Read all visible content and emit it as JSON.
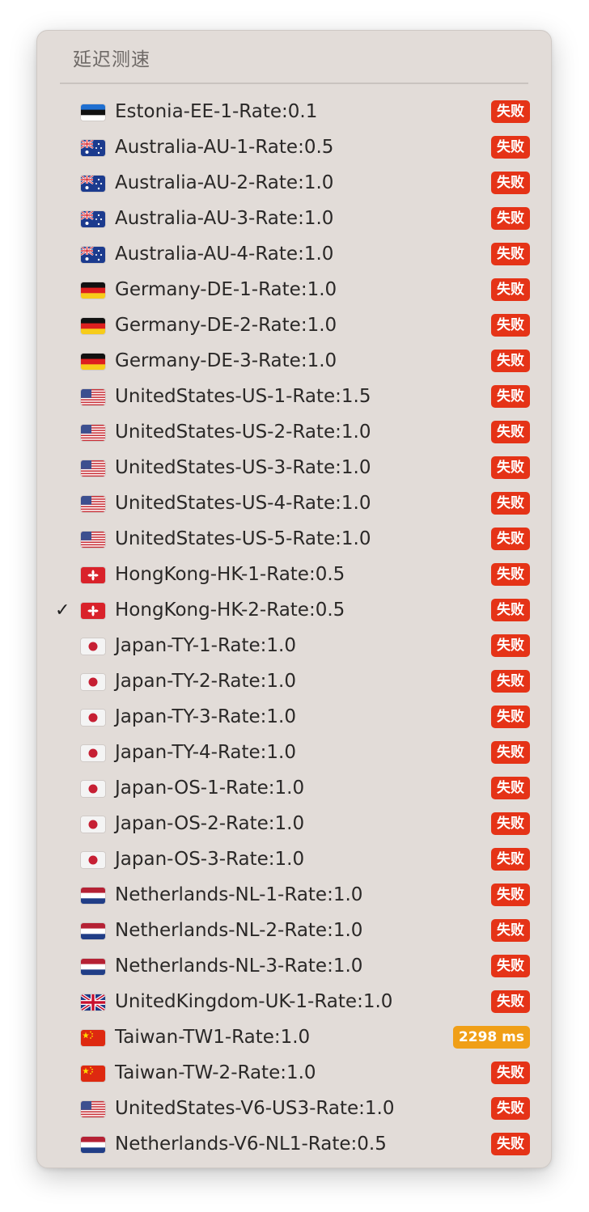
{
  "menu": {
    "title": "延迟测速"
  },
  "colors": {
    "fail_badge": "#e53317",
    "latency_badge": "#f09f17",
    "menu_background": "#e2dcd8"
  },
  "servers": [
    {
      "name": "Estonia-EE-1-Rate:0.1",
      "flag": "estonia-flag-icon",
      "status": "失败",
      "status_type": "fail",
      "selected": false
    },
    {
      "name": "Australia-AU-1-Rate:0.5",
      "flag": "australia-flag-icon",
      "status": "失败",
      "status_type": "fail",
      "selected": false
    },
    {
      "name": "Australia-AU-2-Rate:1.0",
      "flag": "australia-flag-icon",
      "status": "失败",
      "status_type": "fail",
      "selected": false
    },
    {
      "name": "Australia-AU-3-Rate:1.0",
      "flag": "australia-flag-icon",
      "status": "失败",
      "status_type": "fail",
      "selected": false
    },
    {
      "name": "Australia-AU-4-Rate:1.0",
      "flag": "australia-flag-icon",
      "status": "失败",
      "status_type": "fail",
      "selected": false
    },
    {
      "name": "Germany-DE-1-Rate:1.0",
      "flag": "germany-flag-icon",
      "status": "失败",
      "status_type": "fail",
      "selected": false
    },
    {
      "name": "Germany-DE-2-Rate:1.0",
      "flag": "germany-flag-icon",
      "status": "失败",
      "status_type": "fail",
      "selected": false
    },
    {
      "name": "Germany-DE-3-Rate:1.0",
      "flag": "germany-flag-icon",
      "status": "失败",
      "status_type": "fail",
      "selected": false
    },
    {
      "name": "UnitedStates-US-1-Rate:1.5",
      "flag": "usa-flag-icon",
      "status": "失败",
      "status_type": "fail",
      "selected": false
    },
    {
      "name": "UnitedStates-US-2-Rate:1.0",
      "flag": "usa-flag-icon",
      "status": "失败",
      "status_type": "fail",
      "selected": false
    },
    {
      "name": "UnitedStates-US-3-Rate:1.0",
      "flag": "usa-flag-icon",
      "status": "失败",
      "status_type": "fail",
      "selected": false
    },
    {
      "name": "UnitedStates-US-4-Rate:1.0",
      "flag": "usa-flag-icon",
      "status": "失败",
      "status_type": "fail",
      "selected": false
    },
    {
      "name": "UnitedStates-US-5-Rate:1.0",
      "flag": "usa-flag-icon",
      "status": "失败",
      "status_type": "fail",
      "selected": false
    },
    {
      "name": "HongKong-HK-1-Rate:0.5",
      "flag": "hongkong-flag-icon",
      "status": "失败",
      "status_type": "fail",
      "selected": false
    },
    {
      "name": "HongKong-HK-2-Rate:0.5",
      "flag": "hongkong-flag-icon",
      "status": "失败",
      "status_type": "fail",
      "selected": true
    },
    {
      "name": "Japan-TY-1-Rate:1.0",
      "flag": "japan-flag-icon",
      "status": "失败",
      "status_type": "fail",
      "selected": false
    },
    {
      "name": "Japan-TY-2-Rate:1.0",
      "flag": "japan-flag-icon",
      "status": "失败",
      "status_type": "fail",
      "selected": false
    },
    {
      "name": "Japan-TY-3-Rate:1.0",
      "flag": "japan-flag-icon",
      "status": "失败",
      "status_type": "fail",
      "selected": false
    },
    {
      "name": "Japan-TY-4-Rate:1.0",
      "flag": "japan-flag-icon",
      "status": "失败",
      "status_type": "fail",
      "selected": false
    },
    {
      "name": "Japan-OS-1-Rate:1.0",
      "flag": "japan-flag-icon",
      "status": "失败",
      "status_type": "fail",
      "selected": false
    },
    {
      "name": "Japan-OS-2-Rate:1.0",
      "flag": "japan-flag-icon",
      "status": "失败",
      "status_type": "fail",
      "selected": false
    },
    {
      "name": "Japan-OS-3-Rate:1.0",
      "flag": "japan-flag-icon",
      "status": "失败",
      "status_type": "fail",
      "selected": false
    },
    {
      "name": "Netherlands-NL-1-Rate:1.0",
      "flag": "netherlands-flag-icon",
      "status": "失败",
      "status_type": "fail",
      "selected": false
    },
    {
      "name": "Netherlands-NL-2-Rate:1.0",
      "flag": "netherlands-flag-icon",
      "status": "失败",
      "status_type": "fail",
      "selected": false
    },
    {
      "name": "Netherlands-NL-3-Rate:1.0",
      "flag": "netherlands-flag-icon",
      "status": "失败",
      "status_type": "fail",
      "selected": false
    },
    {
      "name": "UnitedKingdom-UK-1-Rate:1.0",
      "flag": "uk-flag-icon",
      "status": "失败",
      "status_type": "fail",
      "selected": false
    },
    {
      "name": "Taiwan-TW1-Rate:1.0",
      "flag": "china-flag-icon",
      "status": "2298 ms",
      "status_type": "ok",
      "selected": false
    },
    {
      "name": "Taiwan-TW-2-Rate:1.0",
      "flag": "china-flag-icon",
      "status": "失败",
      "status_type": "fail",
      "selected": false
    },
    {
      "name": "UnitedStates-V6-US3-Rate:1.0",
      "flag": "usa-flag-icon",
      "status": "失败",
      "status_type": "fail",
      "selected": false
    },
    {
      "name": "Netherlands-V6-NL1-Rate:0.5",
      "flag": "netherlands-flag-icon",
      "status": "失败",
      "status_type": "fail",
      "selected": false
    }
  ]
}
